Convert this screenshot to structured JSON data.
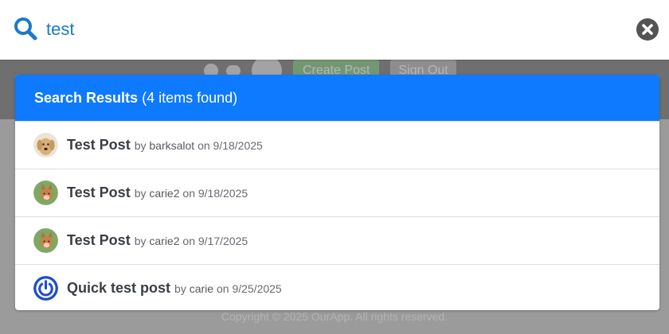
{
  "search": {
    "value": "test"
  },
  "background": {
    "create_post_label": "Create Post",
    "sign_out_label": "Sign Out",
    "footer_text": "Copyright © 2025 OurApp. All rights reserved."
  },
  "results": {
    "title": "Search Results",
    "count_text": "(4 items found)",
    "items": [
      {
        "title": "Test Post",
        "by": "by",
        "author": "barksalot",
        "on": "on",
        "date": "9/18/2025",
        "avatar": "dog-avatar-icon"
      },
      {
        "title": "Test Post",
        "by": "by",
        "author": "carie2",
        "on": "on",
        "date": "9/18/2025",
        "avatar": "fox-avatar-icon"
      },
      {
        "title": "Test Post",
        "by": "by",
        "author": "carie2",
        "on": "on",
        "date": "9/17/2025",
        "avatar": "fox-avatar-icon"
      },
      {
        "title": "Quick test post",
        "by": "by",
        "author": "carie",
        "on": "on",
        "date": "9/25/2025",
        "avatar": "power-avatar-icon"
      }
    ]
  },
  "colors": {
    "accent": "#0d7aff",
    "search_text": "#1b79c9"
  }
}
